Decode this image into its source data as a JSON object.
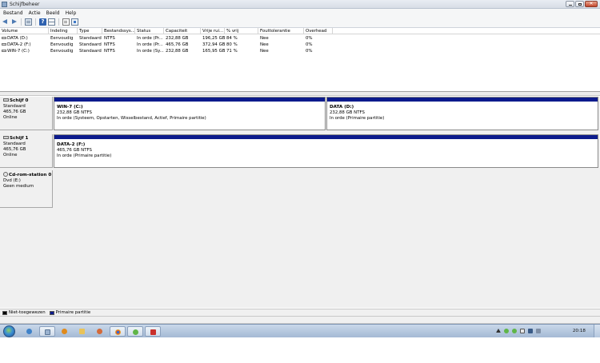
{
  "window": {
    "title": "Schijfbeheer"
  },
  "menu": [
    "Bestand",
    "Actie",
    "Beeld",
    "Help"
  ],
  "toolbar": {
    "icons": [
      "arrow-left-icon",
      "arrow-right-icon",
      "panel-icon",
      "help-icon",
      "grid-icon",
      "document-icon",
      "properties-icon"
    ]
  },
  "volume_table": {
    "columns": [
      "Volume",
      "Indeling",
      "Type",
      "Bestandssys...",
      "Status",
      "Capaciteit",
      "Vrije rui...",
      "% vrij",
      "Fouttolerantie",
      "Overhead"
    ],
    "rows": [
      [
        "DATA (D:)",
        "Eenvoudig",
        "Standaard",
        "NTFS",
        "In orde (Pr...",
        "232,88 GB",
        "196,25 GB",
        "84 %",
        "Nee",
        "0%"
      ],
      [
        "DATA-2 (F:)",
        "Eenvoudig",
        "Standaard",
        "NTFS",
        "In orde (Pr...",
        "465,76 GB",
        "372,94 GB",
        "80 %",
        "Nee",
        "0%"
      ],
      [
        "WIN-7 (C:)",
        "Eenvoudig",
        "Standaard",
        "NTFS",
        "In orde (Sy...",
        "232,88 GB",
        "165,95 GB",
        "71 %",
        "Nee",
        "0%"
      ]
    ]
  },
  "disks": [
    {
      "name": "Schijf 0",
      "type": "Standaard",
      "size": "465,76 GB",
      "state": "Online",
      "partitions": [
        {
          "name": "WIN-7  (C:)",
          "size": "232,88 GB NTFS",
          "status": "In orde (Systeem, Opstarten, Wisselbestand, Actief, Primaire partitie)"
        },
        {
          "name": "DATA  (D:)",
          "size": "232,88 GB NTFS",
          "status": "In orde (Primaire partitie)"
        }
      ]
    },
    {
      "name": "Schijf 1",
      "type": "Standaard",
      "size": "465,76 GB",
      "state": "Online",
      "partitions": [
        {
          "name": "DATA-2  (F:)",
          "size": "465,76 GB NTFS",
          "status": "In orde (Primaire partitie)"
        }
      ]
    },
    {
      "name": "Cd-rom-station 0",
      "type": "Dvd (E:)",
      "size": "",
      "state": "Geen medium",
      "partitions": []
    }
  ],
  "legend": [
    {
      "label": "Niet-toegewezen",
      "color": "#000000"
    },
    {
      "label": "Primaire partitie",
      "color": "#0c1b8c"
    }
  ],
  "taskbar": {
    "clock": "20:18",
    "buttons": [
      "explorer-icon",
      "wmp-icon",
      "folder-icon",
      "computer-management-icon",
      "chrome-icon",
      "torrent-icon",
      "snipping-tool-icon"
    ]
  },
  "colors": {
    "primary_partition": "#0c1b8c",
    "unallocated": "#000000"
  }
}
